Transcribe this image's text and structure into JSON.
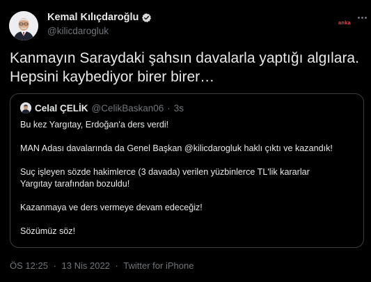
{
  "author": {
    "name": "Kemal Kılıçdaroğlu",
    "handle": "@kilicdarogluk"
  },
  "watermark": "anka",
  "tweet": {
    "text_lines": [
      "Kanmayın Saraydaki şahsın davalarla yaptığı algılara.",
      "Hepsini kaybediyor birer birer…"
    ]
  },
  "quote": {
    "name": "Celal ÇELİK",
    "handle": "@CelikBaskan06",
    "separator": "·",
    "time": "3s",
    "lines": [
      "Bu kez Yargıtay, Erdoğan'a ders verdi!",
      "",
      "MAN Adası davalarında da Genel Başkan @kilicdarogluk haklı çıktı ve kazandık!",
      "",
      "Suç işleyen sözde hakimlerce (3 davada) verilen yüzbinlerce TL'lik kararlar",
      "Yargıtay tarafından bozuldu!",
      "",
      "Kazanmaya ve ders vermeye devam edeceğiz!",
      "",
      "Sözümüz söz!"
    ]
  },
  "footer": {
    "time": "ÖS 12:25",
    "separator": "·",
    "date": "13 Nis 2022",
    "source": "Twitter for iPhone"
  },
  "colors": {
    "background": "#000000",
    "text": "#e7e9ea",
    "muted": "#71767b",
    "border": "#3a3d41",
    "verified": "#d9d9d9"
  },
  "icons": [
    "verified-badge-icon",
    "more-options-icon"
  ]
}
